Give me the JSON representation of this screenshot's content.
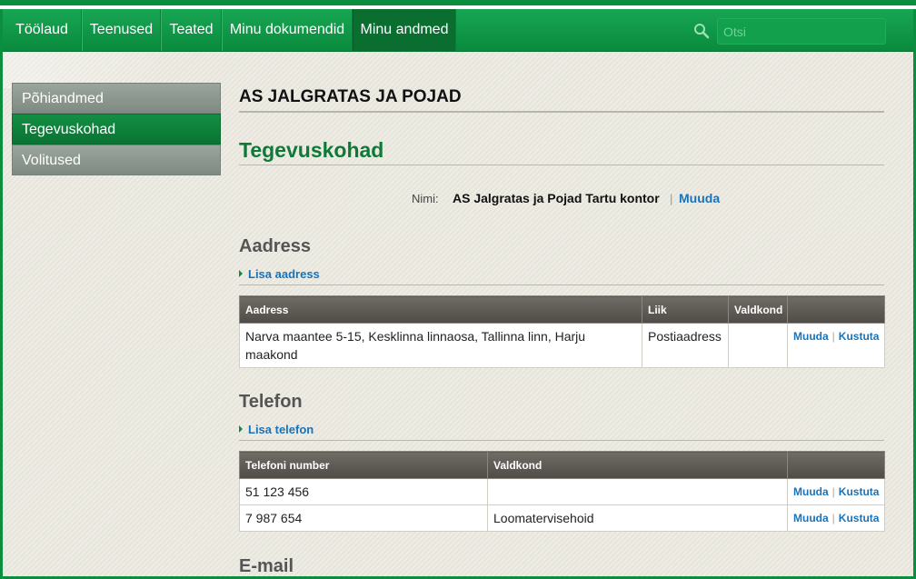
{
  "nav": {
    "items": [
      "Töölaud",
      "Teenused",
      "Teated",
      "Minu dokumendid",
      "Minu andmed"
    ],
    "active_index": 4,
    "search_placeholder": "Otsi"
  },
  "sidebar": {
    "items": [
      "Põhiandmed",
      "Tegevuskohad",
      "Volitused"
    ],
    "active_index": 1
  },
  "main": {
    "company_name": "AS JALGRATAS JA POJAD",
    "page_title": "Tegevuskohad",
    "name_label": "Nimi:",
    "name_value": "AS Jalgratas ja Pojad Tartu kontor",
    "name_separator": "|",
    "edit_label": "Muuda",
    "address": {
      "title": "Aadress",
      "add_label": "Lisa aadress",
      "columns": [
        "Aadress",
        "Liik",
        "Valdkond",
        ""
      ],
      "rows": [
        {
          "address": "Narva maantee 5-15, Kesklinna linnaosa, Tallinna linn, Harju maakond",
          "type": "Postiaadress",
          "field": "",
          "edit": "Muuda",
          "delete": "Kustuta"
        }
      ]
    },
    "phone": {
      "title": "Telefon",
      "add_label": "Lisa telefon",
      "columns": [
        "Telefoni number",
        "Valdkond",
        ""
      ],
      "rows": [
        {
          "number": "51 123 456",
          "field": "",
          "edit": "Muuda",
          "delete": "Kustuta"
        },
        {
          "number": "7 987 654",
          "field": "Loomatervisehoid",
          "edit": "Muuda",
          "delete": "Kustuta"
        }
      ]
    },
    "email": {
      "title": "E-mail"
    }
  },
  "colors": {
    "brand_green": "#0b8f3e",
    "link_blue": "#1a73b8",
    "title_green": "#0f7a37"
  }
}
